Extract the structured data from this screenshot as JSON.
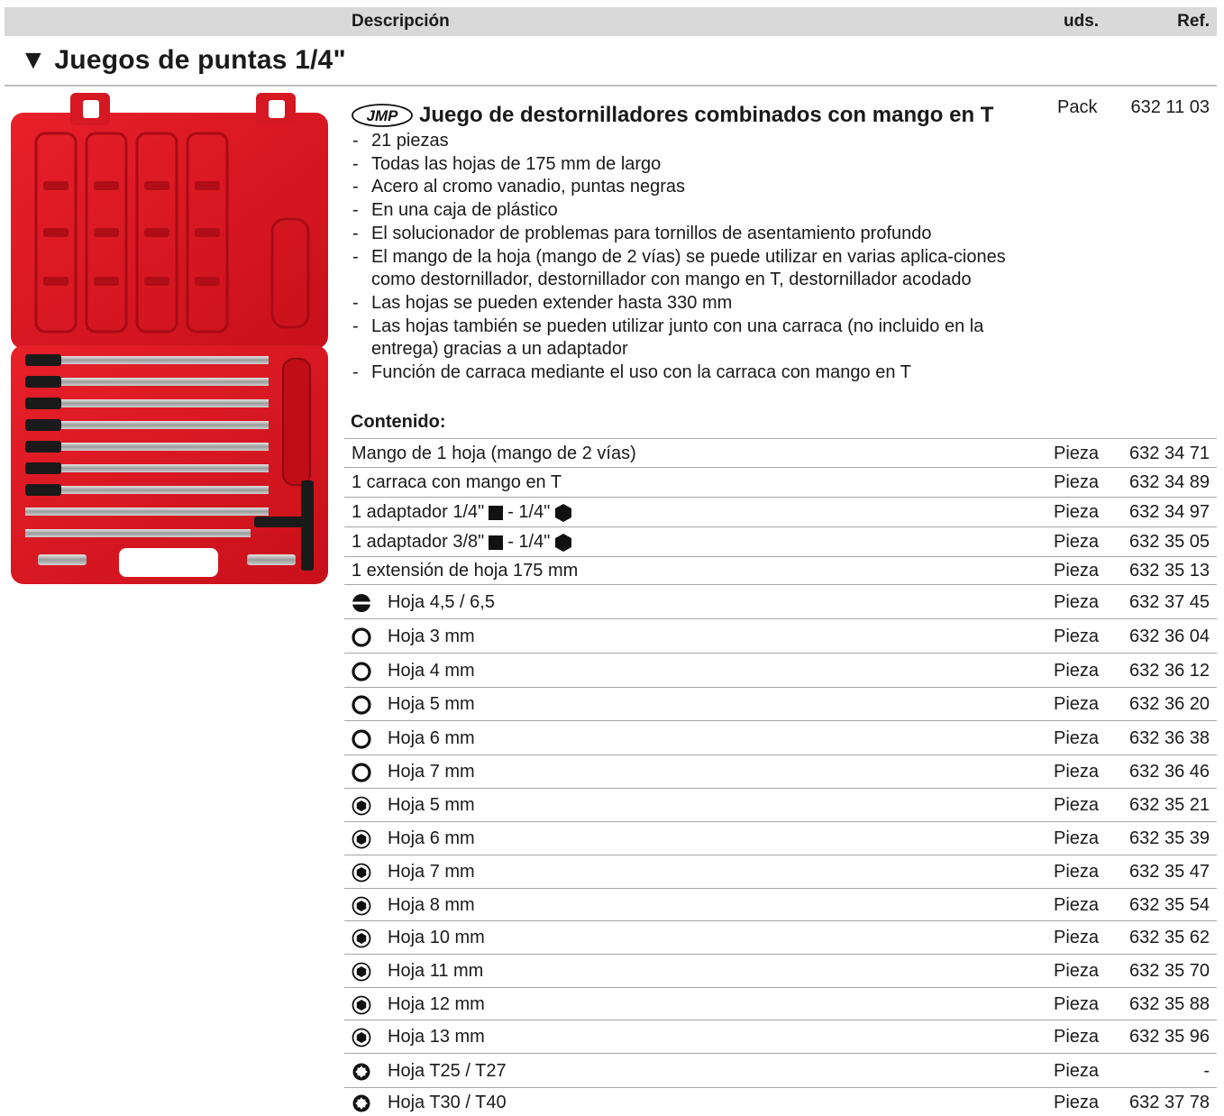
{
  "header": {
    "desc": "Descripción",
    "uds": "uds.",
    "ref": "Ref."
  },
  "section": {
    "title": "▼ Juegos de puntas 1/4\""
  },
  "product": {
    "brand": "JMP",
    "title": "Juego de destornilladores combinados con mango en T",
    "uds": "Pack",
    "ref": "632 11 03",
    "features": [
      "21 piezas",
      "Todas las hojas de 175 mm de largo",
      "Acero al cromo vanadio, puntas negras",
      "En una caja de plástico",
      "El solucionador de problemas para tornillos de asentamiento profundo",
      "El mango de la hoja (mango de 2 vías) se puede utilizar en varias aplica-ciones como destornillador, destornillador con mango en T, destornillador acodado",
      "Las hojas se pueden extender hasta 330 mm",
      "Las hojas también se pueden utilizar junto con una carraca (no incluido en la entrega) gracias a un adaptador",
      "Función de carraca mediante el uso con la carraca con mango en T"
    ],
    "contents_label": "Contenido:"
  },
  "rows": [
    {
      "icon": "",
      "text": "Mango de 1 hoja (mango de 2 vías)",
      "uds": "Pieza",
      "ref": "632 34 71"
    },
    {
      "icon": "",
      "text": "1 carraca con mango en T",
      "uds": "Pieza",
      "ref": "632 34 89"
    },
    {
      "icon": "",
      "text_a": "1 adaptador 1/4\"",
      "text_b": "- 1/4\"",
      "uds": "Pieza",
      "ref": "632 34 97"
    },
    {
      "icon": "",
      "text_a": "1 adaptador 3/8\"",
      "text_b": "- 1/4\"",
      "uds": "Pieza",
      "ref": "632 35 05"
    },
    {
      "icon": "",
      "text": "1 extensión de hoja 175 mm",
      "uds": "Pieza",
      "ref": "632 35 13"
    },
    {
      "icon": "slotted-icon",
      "text": "Hoja 4,5 / 6,5",
      "uds": "Pieza",
      "ref": "632 37 45"
    },
    {
      "icon": "hex-socket-icon",
      "text": "Hoja 3 mm",
      "uds": "Pieza",
      "ref": "632 36 04"
    },
    {
      "icon": "hex-socket-icon",
      "text": "Hoja 4 mm",
      "uds": "Pieza",
      "ref": "632 36 12"
    },
    {
      "icon": "hex-socket-icon",
      "text": "Hoja 5 mm",
      "uds": "Pieza",
      "ref": "632 36 20"
    },
    {
      "icon": "hex-socket-icon",
      "text": "Hoja 6 mm",
      "uds": "Pieza",
      "ref": "632 36 38"
    },
    {
      "icon": "hex-socket-icon",
      "text": "Hoja 7 mm",
      "uds": "Pieza",
      "ref": "632 36 46"
    },
    {
      "icon": "socket-icon",
      "text": "Hoja 5 mm",
      "uds": "Pieza",
      "ref": "632 35 21"
    },
    {
      "icon": "socket-icon",
      "text": "Hoja 6 mm",
      "uds": "Pieza",
      "ref": "632 35 39"
    },
    {
      "icon": "socket-icon",
      "text": "Hoja 7 mm",
      "uds": "Pieza",
      "ref": "632 35 47"
    },
    {
      "icon": "socket-icon",
      "text": "Hoja 8 mm",
      "uds": "Pieza",
      "ref": "632 35 54"
    },
    {
      "icon": "socket-icon",
      "text": "Hoja 10 mm",
      "uds": "Pieza",
      "ref": "632 35 62"
    },
    {
      "icon": "socket-icon",
      "text": "Hoja 11 mm",
      "uds": "Pieza",
      "ref": "632 35 70"
    },
    {
      "icon": "socket-icon",
      "text": "Hoja 12 mm",
      "uds": "Pieza",
      "ref": "632 35 88"
    },
    {
      "icon": "socket-icon",
      "text": "Hoja 13 mm",
      "uds": "Pieza",
      "ref": "632 35 96"
    },
    {
      "icon": "torx-icon",
      "text": "Hoja T25 / T27",
      "uds": "Pieza",
      "ref": "-"
    },
    {
      "icon": "torx-icon",
      "text": "Hoja T30 / T40",
      "uds": "Pieza",
      "ref": "632 37 78"
    }
  ]
}
